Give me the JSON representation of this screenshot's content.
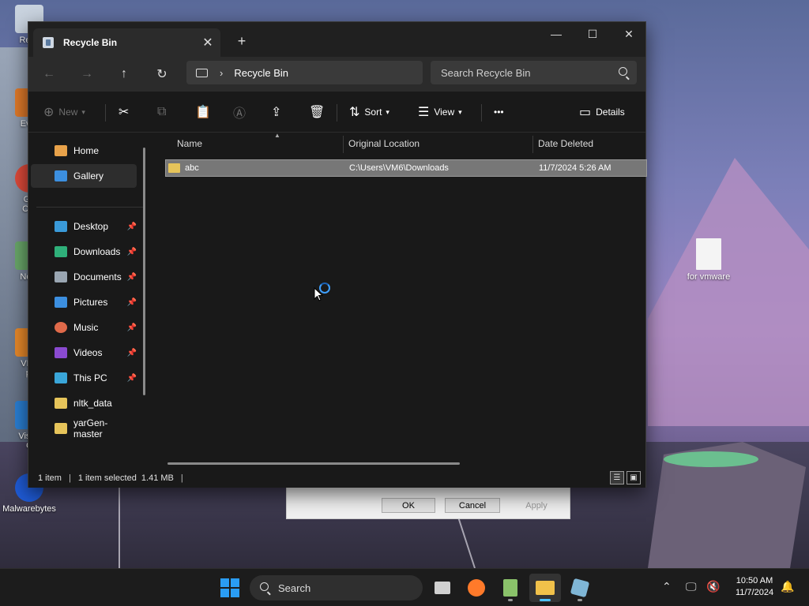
{
  "desktop": {
    "icons": [
      {
        "label": "Recy",
        "icon": "recycle-bin-icon"
      },
      {
        "label": "Ever",
        "icon": "shortcut-icon"
      },
      {
        "label": "Go",
        "label2": "Chr",
        "icon": "chrome-icon"
      },
      {
        "label": "Note",
        "icon": "notepad-icon"
      },
      {
        "label": "VLC",
        "label2": "pl",
        "icon": "vlc-icon"
      },
      {
        "label": "Visua",
        "label2": "C",
        "icon": "vscode-icon"
      },
      {
        "label": "Malwarebytes",
        "icon": "malwarebytes-icon"
      },
      {
        "label": "for vmware",
        "icon": "text-file-icon"
      }
    ]
  },
  "dialog_behind": {
    "ok": "OK",
    "cancel": "Cancel",
    "apply": "Apply"
  },
  "window": {
    "tab_title": "Recycle Bin",
    "new_tab": "+",
    "minimize": "—",
    "maximize": "☐",
    "close": "✕"
  },
  "navbar": {
    "back": "←",
    "forward": "→",
    "up": "↑",
    "refresh": "↻",
    "breadcrumb": "Recycle Bin",
    "search_placeholder": "Search Recycle Bin"
  },
  "commands": {
    "new": "New",
    "sort": "Sort",
    "view": "View",
    "more": "•••",
    "details": "Details"
  },
  "sidebar": {
    "top": [
      {
        "label": "Home",
        "icon": "home-icon"
      },
      {
        "label": "Gallery",
        "icon": "gallery-icon",
        "selected": true
      }
    ],
    "pinned": [
      {
        "label": "Desktop",
        "icon": "desktop-icon",
        "pinned": true
      },
      {
        "label": "Downloads",
        "icon": "downloads-icon",
        "pinned": true
      },
      {
        "label": "Documents",
        "icon": "documents-icon",
        "pinned": true
      },
      {
        "label": "Pictures",
        "icon": "pictures-icon",
        "pinned": true
      },
      {
        "label": "Music",
        "icon": "music-icon",
        "pinned": true
      },
      {
        "label": "Videos",
        "icon": "videos-icon",
        "pinned": true
      },
      {
        "label": "This PC",
        "icon": "this-pc-icon",
        "pinned": true
      },
      {
        "label": "nltk_data",
        "icon": "folder-icon",
        "pinned": false
      },
      {
        "label": "yarGen-master",
        "icon": "folder-icon",
        "pinned": false
      }
    ]
  },
  "table": {
    "columns": [
      "Name",
      "Original Location",
      "Date Deleted"
    ],
    "rows": [
      {
        "name": "abc",
        "location": "C:\\Users\\VM6\\Downloads",
        "date": "11/7/2024 5:26 AM",
        "selected": true
      }
    ]
  },
  "status": {
    "count": "1 item",
    "selection": "1 item selected  1.41 MB"
  },
  "taskbar": {
    "search": "Search",
    "time": "10:50 AM",
    "date": "11/7/2024"
  }
}
